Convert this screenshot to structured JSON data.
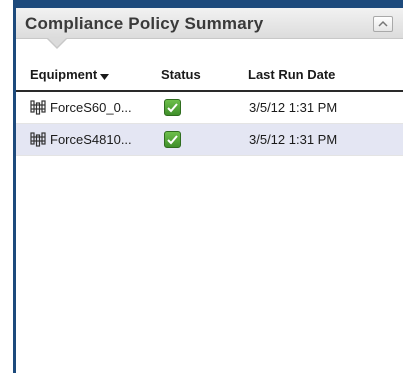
{
  "panel": {
    "title": "Compliance Policy Summary",
    "collapse_icon": "chevron-up-icon"
  },
  "table": {
    "columns": [
      {
        "label": "Equipment",
        "sort": "descending"
      },
      {
        "label": "Status"
      },
      {
        "label": "Last Run Date"
      }
    ],
    "rows": [
      {
        "equipment": "ForceS60_0...",
        "status_icon": "check-icon",
        "last_run": "3/5/12 1:31 PM"
      },
      {
        "equipment": "ForceS4810...",
        "status_icon": "check-icon",
        "last_run": "3/5/12 1:31 PM"
      }
    ]
  },
  "colors": {
    "frame": "#1d4a7c",
    "selected_row": "#e4e6f3",
    "status_ok": "#4fa334"
  }
}
